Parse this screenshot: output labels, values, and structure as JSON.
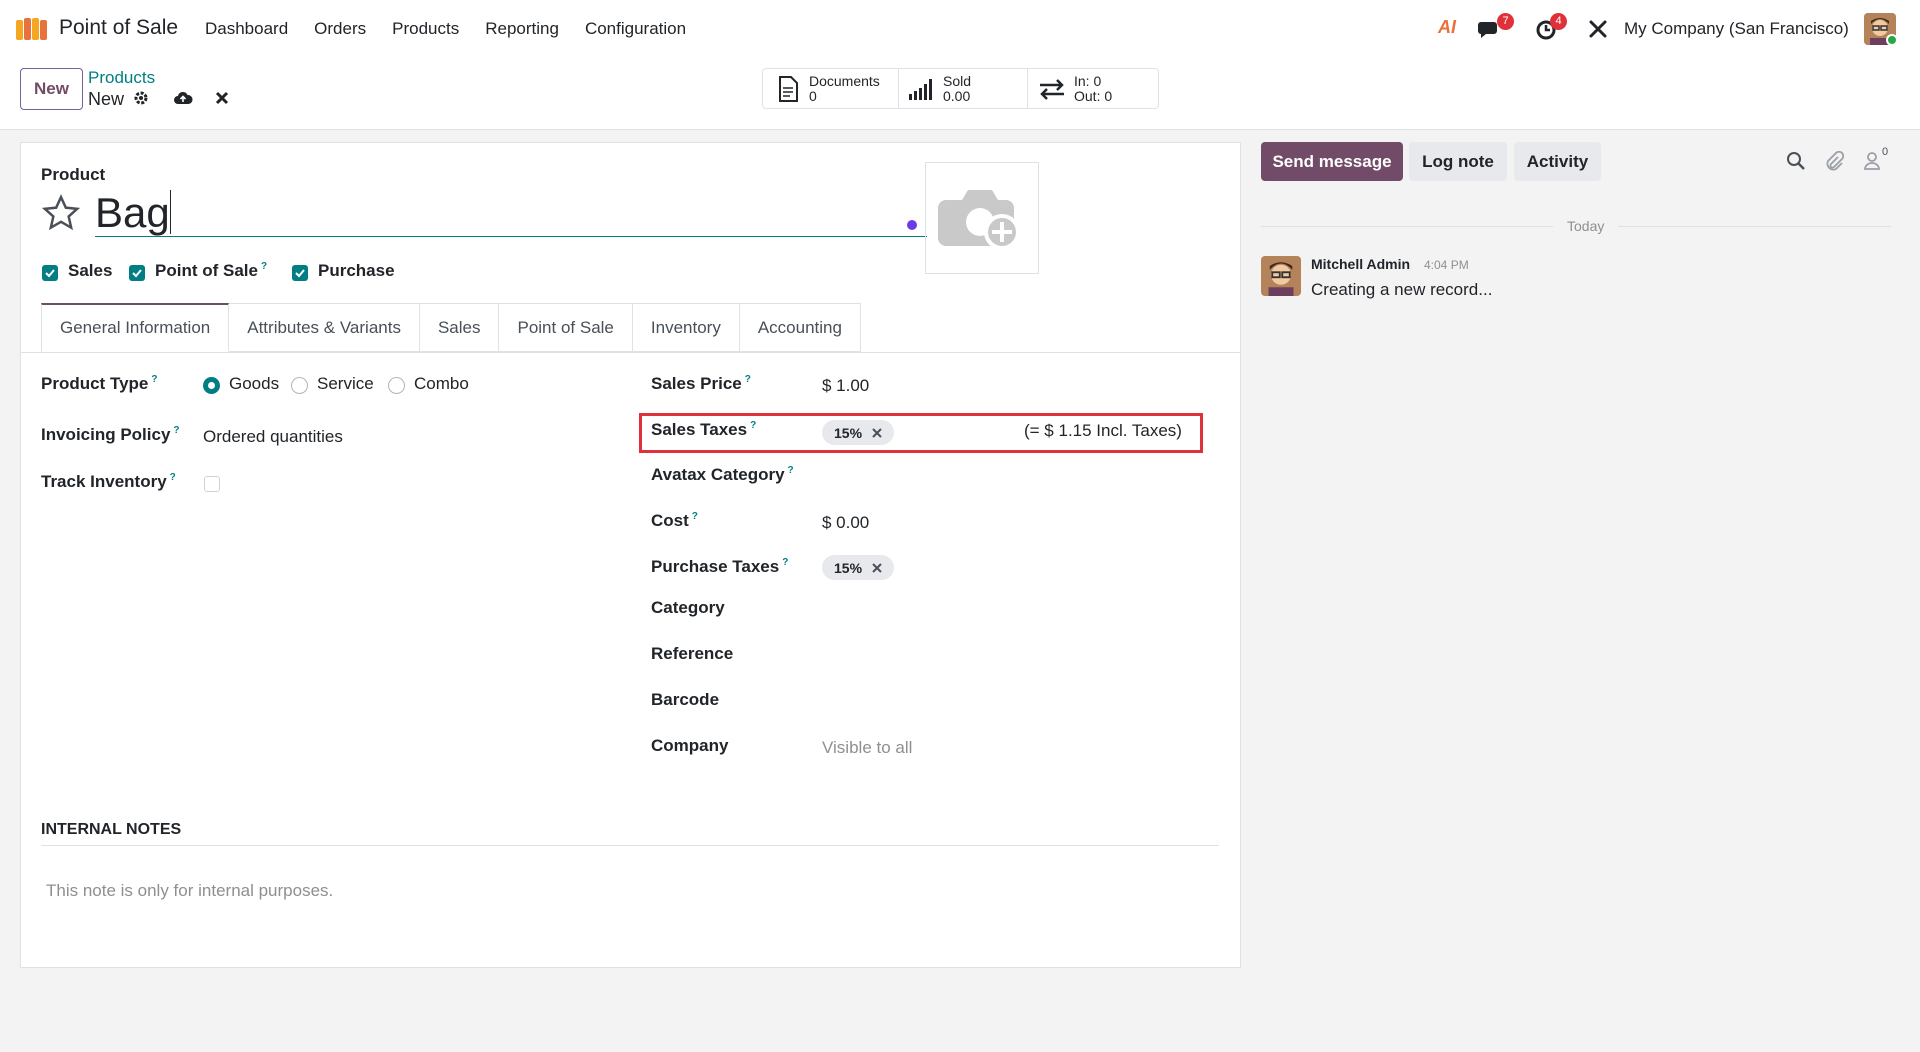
{
  "navbar": {
    "app_name": "Point of Sale",
    "menu": [
      "Dashboard",
      "Orders",
      "Products",
      "Reporting",
      "Configuration"
    ],
    "ai_label": "AI",
    "messages_badge": "7",
    "activities_badge": "4",
    "company": "My Company (San Francisco)"
  },
  "control": {
    "new_label": "New",
    "breadcrumb_parent": "Products",
    "breadcrumb_current": "New",
    "stats": [
      {
        "name": "Documents",
        "value": "0"
      },
      {
        "name": "Sold",
        "value": "0.00"
      },
      {
        "in": "In: 0",
        "out": "Out: 0"
      }
    ]
  },
  "form": {
    "product_label": "Product",
    "product_name": "Bag",
    "flags": [
      {
        "label": "Sales",
        "checked": true
      },
      {
        "label": "Point of Sale",
        "checked": true,
        "help": true
      },
      {
        "label": "Purchase",
        "checked": true
      }
    ],
    "tabs": [
      "General Information",
      "Attributes & Variants",
      "Sales",
      "Point of Sale",
      "Inventory",
      "Accounting"
    ],
    "active_tab": "General Information",
    "left": {
      "product_type_label": "Product Type",
      "product_type_options": [
        "Goods",
        "Service",
        "Combo"
      ],
      "product_type_selected": "Goods",
      "invoicing_policy_label": "Invoicing Policy",
      "invoicing_policy_value": "Ordered quantities",
      "track_inventory_label": "Track Inventory",
      "track_inventory": false
    },
    "right": {
      "sales_price_label": "Sales Price",
      "sales_price_value": "$ 1.00",
      "sales_taxes_label": "Sales Taxes",
      "sales_taxes_tag": "15%",
      "sales_taxes_incl": "(= $ 1.15 Incl. Taxes)",
      "avatax_label": "Avatax Category",
      "cost_label": "Cost",
      "cost_value": "$ 0.00",
      "purchase_taxes_label": "Purchase Taxes",
      "purchase_taxes_tag": "15%",
      "category_label": "Category",
      "reference_label": "Reference",
      "barcode_label": "Barcode",
      "company_label": "Company",
      "company_placeholder": "Visible to all"
    },
    "internal_notes_label": "INTERNAL NOTES",
    "internal_notes_placeholder": "This note is only for internal purposes."
  },
  "chatter": {
    "send_message": "Send message",
    "log_note": "Log note",
    "activity": "Activity",
    "followers_count": "0",
    "date_separator": "Today",
    "messages": [
      {
        "author": "Mitchell Admin",
        "time": "4:04 PM",
        "body": "Creating a new record..."
      }
    ]
  },
  "colors": {
    "brand": "#714b67",
    "accent": "#017e84",
    "highlight_box": "#e0313a"
  }
}
